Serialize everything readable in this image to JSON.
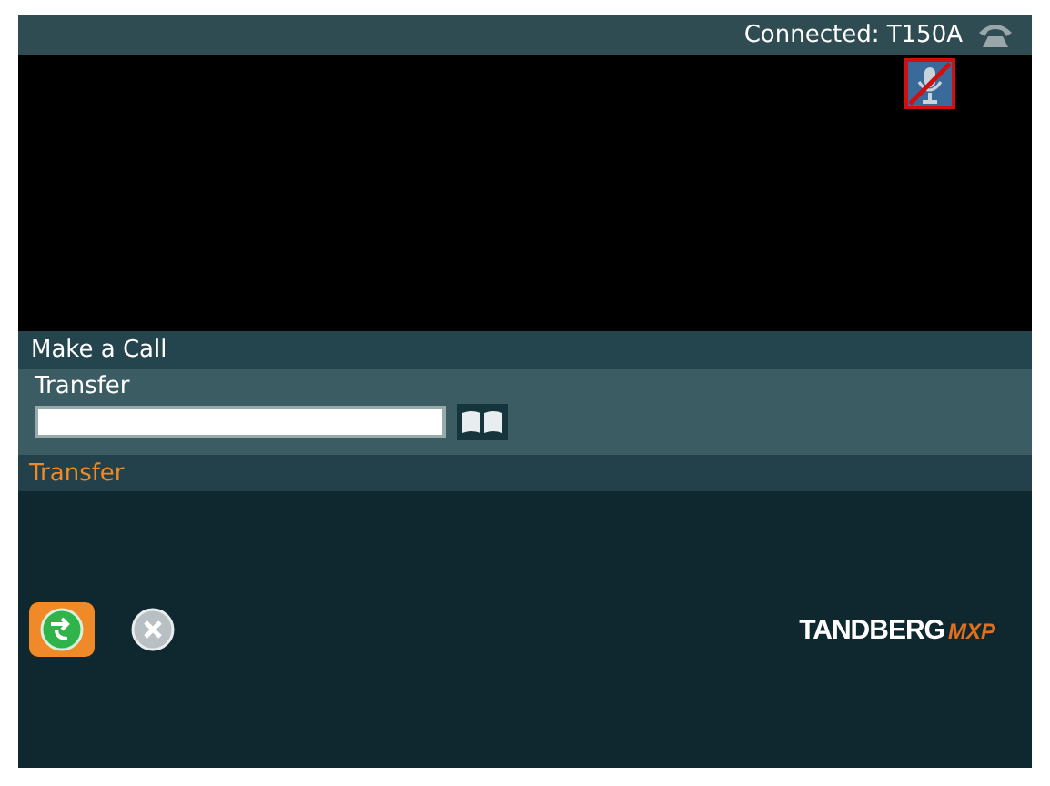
{
  "status_bar": {
    "text": "Connected: T150A"
  },
  "menu": {
    "title": "Make a Call"
  },
  "panel": {
    "title": "Transfer"
  },
  "action_label": "Transfer",
  "buttons": [
    {
      "kind": "transfer",
      "selected": true
    },
    {
      "kind": "cancel",
      "selected": false
    }
  ],
  "logo": {
    "brand": "TANDBERG",
    "suffix": "MXP"
  }
}
